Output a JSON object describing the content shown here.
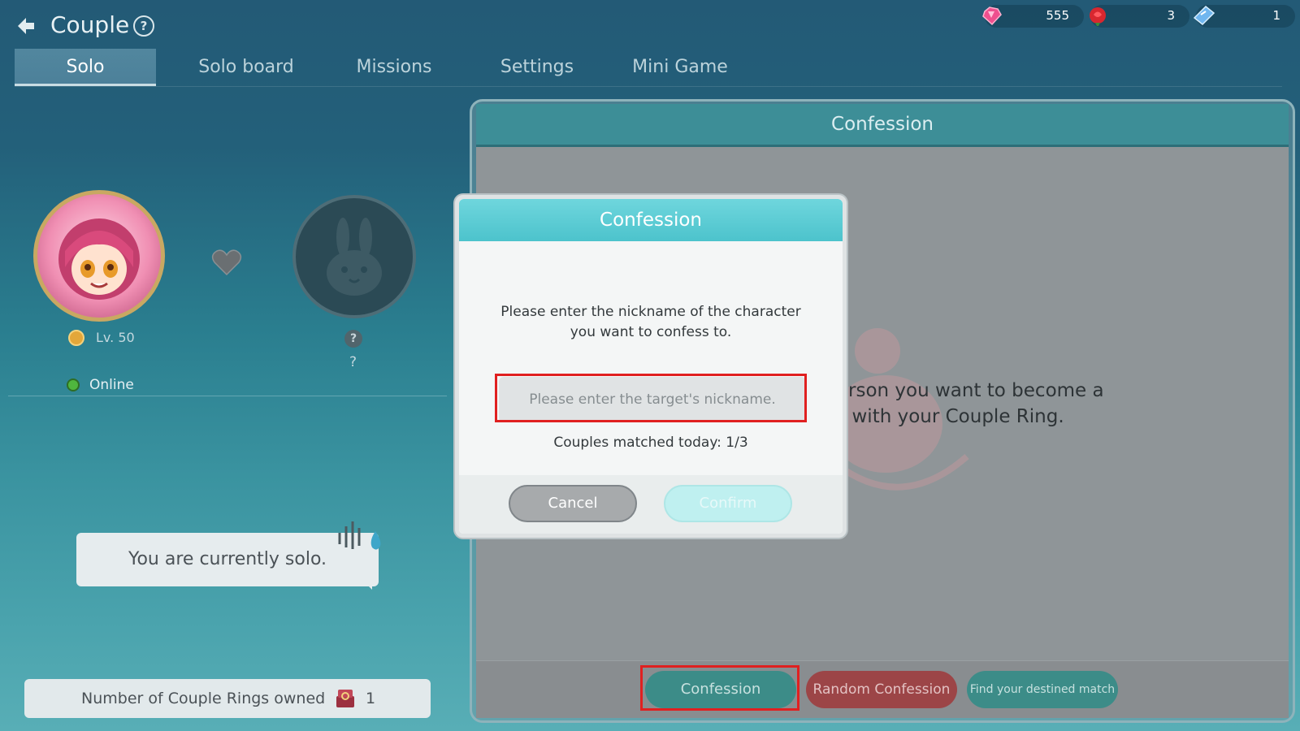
{
  "header": {
    "title": "Couple",
    "help_icon_glyph": "?",
    "currencies": [
      {
        "icon": "pink-gem-icon",
        "value": "555"
      },
      {
        "icon": "rose-icon",
        "value": "3"
      },
      {
        "icon": "blue-ticket-icon",
        "value": "1"
      }
    ]
  },
  "tabs": [
    {
      "label": "Solo",
      "active": true
    },
    {
      "label": "Solo board",
      "active": false
    },
    {
      "label": "Missions",
      "active": false
    },
    {
      "label": "Settings",
      "active": false
    },
    {
      "label": "Mini Game",
      "active": false
    }
  ],
  "profile": {
    "level": "Lv. 50",
    "status": "Online",
    "partner_name": "?",
    "partner_badge": "?",
    "solo_message": "You are currently solo.",
    "rings_label": "Number of Couple Rings owned",
    "rings_count": "1"
  },
  "panel": {
    "title": "Confession",
    "description_line1": "rson you want to become a",
    "description_line2": "ng with your Couple Ring.",
    "buttons": {
      "confession": "Confession",
      "random": "Random Confession",
      "destined": "Find your destined match"
    }
  },
  "modal": {
    "title": "Confession",
    "message_line1": "Please enter the nickname of the character",
    "message_line2": "you want to confess to.",
    "input_placeholder": "Please enter the target's nickname.",
    "input_value": "",
    "matched": "Couples matched today: 1/3",
    "cancel": "Cancel",
    "confirm": "Confirm"
  },
  "colors": {
    "accent_teal": "#4cc3cc",
    "highlight_red": "#e02020",
    "random_red": "#9c4547"
  }
}
